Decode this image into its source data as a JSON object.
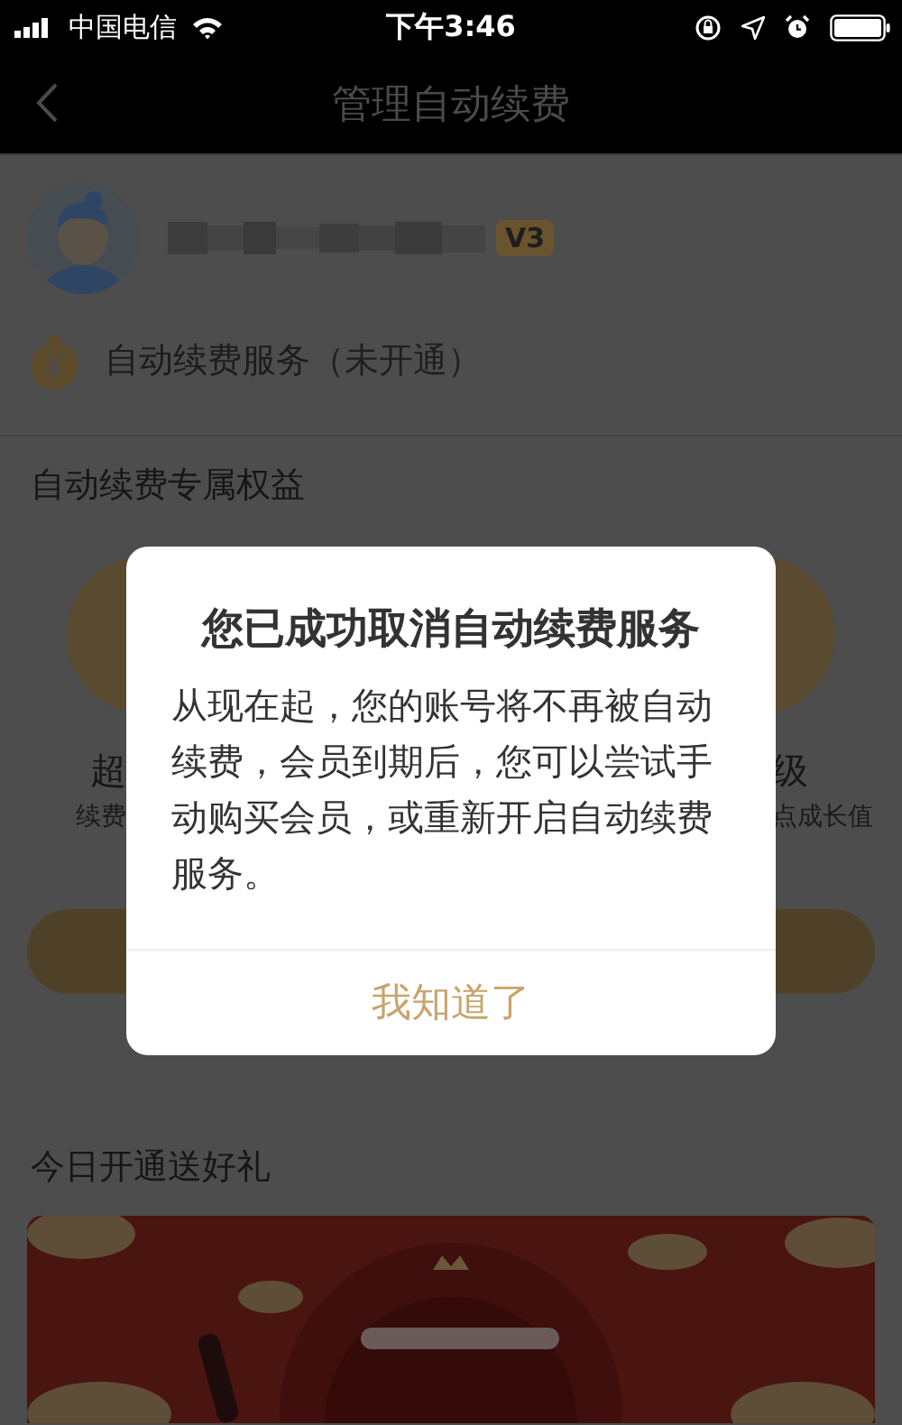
{
  "status_bar": {
    "carrier": "中国电信",
    "time": "下午3:46"
  },
  "nav": {
    "title": "管理自动续费"
  },
  "profile": {
    "badge": "V3"
  },
  "service": {
    "label": "自动续费服务",
    "status": "（未开通）"
  },
  "benefits": {
    "title": "自动续费专属权益",
    "items": [
      {
        "title": "超",
        "subtitle": "续费"
      },
      {
        "title": "级",
        "subtitle": "点成长值"
      }
    ]
  },
  "gift": {
    "title": "今日开通送好礼"
  },
  "dialog": {
    "title": "您已成功取消自动续费服务",
    "message": "从现在起，您的账号将不再被自动续费，会员到期后，您可以尝试手动购买会员，或重新开启自动续费服务。",
    "button": "我知道了"
  }
}
